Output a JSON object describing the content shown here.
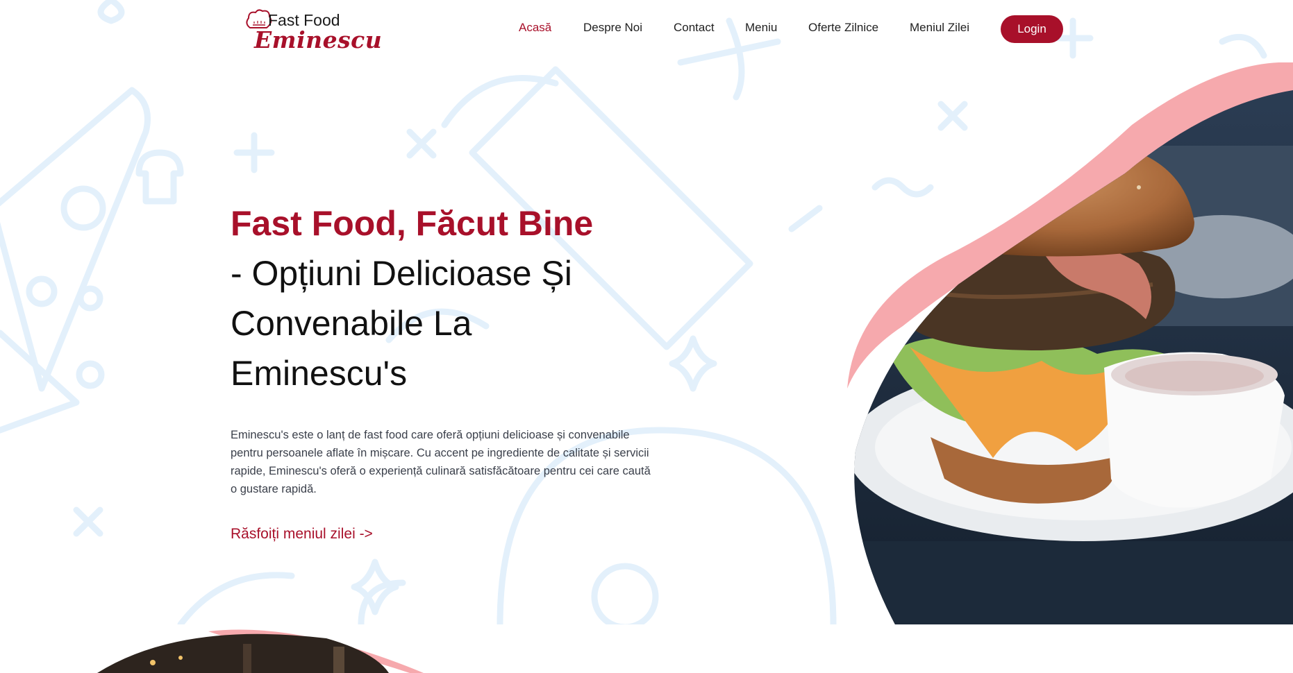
{
  "brand": {
    "logo_line1": "Fast Food",
    "logo_line2": "Eminescu"
  },
  "nav": {
    "items": [
      {
        "label": "Acasă",
        "active": true
      },
      {
        "label": "Despre Noi",
        "active": false
      },
      {
        "label": "Contact",
        "active": false
      },
      {
        "label": "Meniu",
        "active": false
      },
      {
        "label": "Oferte Zilnice",
        "active": false
      },
      {
        "label": "Meniul Zilei",
        "active": false
      }
    ],
    "login_label": "Login"
  },
  "hero": {
    "title_accent": "Fast Food, Făcut Bine",
    "title_rest": "- Opțiuni Delicioase Și Convenabile La Eminescu's",
    "description": "Eminescu's este o lanț de fast food care oferă opțiuni delicioase și convenabile pentru persoanele aflate în mișcare. Cu accent pe ingrediente de calitate și servicii rapide, Eminescu's oferă o experiență culinară satisfăcătoare pentru cei care caută o gustare rapidă.",
    "cta_label": "Răsfoiți meniul zilei ->"
  },
  "colors": {
    "brand": "#a8102a",
    "blob": "#f6a9ad",
    "doodle": "#e3f0fb",
    "text_body": "#3a3f4a"
  },
  "icons": {
    "logo": "chef-hat-icon",
    "background": "food-doodles-pattern"
  }
}
